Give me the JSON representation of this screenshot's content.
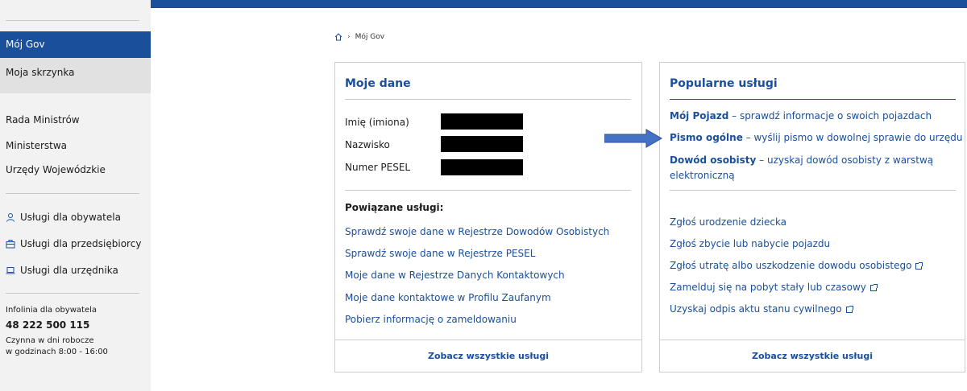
{
  "sidebar": {
    "active_item": "Mój Gov",
    "second_item": "Moja skrzynka",
    "links": [
      "Rada Ministrów",
      "Ministerstwa",
      "Urzędy Wojewódzkie"
    ],
    "services": [
      {
        "label": "Usługi dla obywatela",
        "icon": "person-icon"
      },
      {
        "label": "Usługi dla przedsiębiorcy",
        "icon": "briefcase-icon"
      },
      {
        "label": "Usługi dla urzędnika",
        "icon": "laptop-icon"
      }
    ],
    "infoline": {
      "title": "Infolinia dla obywatela",
      "phone": "48 222 500 115",
      "hours_line1": "Czynna w dni robocze",
      "hours_line2": "w godzinach 8:00 - 16:00"
    }
  },
  "breadcrumb": {
    "home_icon": "home-icon",
    "current": "Mój Gov"
  },
  "moje_dane": {
    "title": "Moje dane",
    "fields": [
      {
        "label": "Imię (imiona)"
      },
      {
        "label": "Nazwisko"
      },
      {
        "label": "Numer PESEL"
      }
    ],
    "related_title": "Powiązane usługi:",
    "related_links": [
      "Sprawdź swoje dane w Rejestrze Dowodów Osobistych",
      "Sprawdź swoje dane w Rejestrze PESEL",
      "Moje dane w Rejestrze Danych Kontaktowych",
      "Moje dane kontaktowe w Profilu Zaufanym",
      "Pobierz informację o zameldowaniu"
    ],
    "footer_link": "Zobacz wszystkie usługi"
  },
  "popularne": {
    "title": "Popularne usługi",
    "featured": [
      {
        "bold": "Mój Pojazd",
        "rest": " – sprawdź informacje o swoich pojazdach"
      },
      {
        "bold": "Pismo ogólne",
        "rest": " – wyślij pismo w dowolnej sprawie do urzędu"
      },
      {
        "bold": "Dowód osobisty",
        "rest": " – uzyskaj dowód osobisty z warstwą",
        "rest2": "elektroniczną"
      }
    ],
    "links": [
      {
        "label": "Zgłoś urodzenie dziecka",
        "external": false
      },
      {
        "label": "Zgłoś zbycie lub nabycie pojazdu",
        "external": false
      },
      {
        "label": "Zgłoś utratę albo uszkodzenie dowodu osobistego",
        "external": true
      },
      {
        "label": "Zamelduj się na pobyt stały lub czasowy",
        "external": true
      },
      {
        "label": "Uzyskaj odpis aktu stanu cywilnego",
        "external": true
      }
    ],
    "footer_link": "Zobacz wszystkie usługi"
  },
  "colors": {
    "brand": "#1a4f9c",
    "sidebar_bg": "#f2f2f2",
    "arrow": "#4472c4"
  }
}
